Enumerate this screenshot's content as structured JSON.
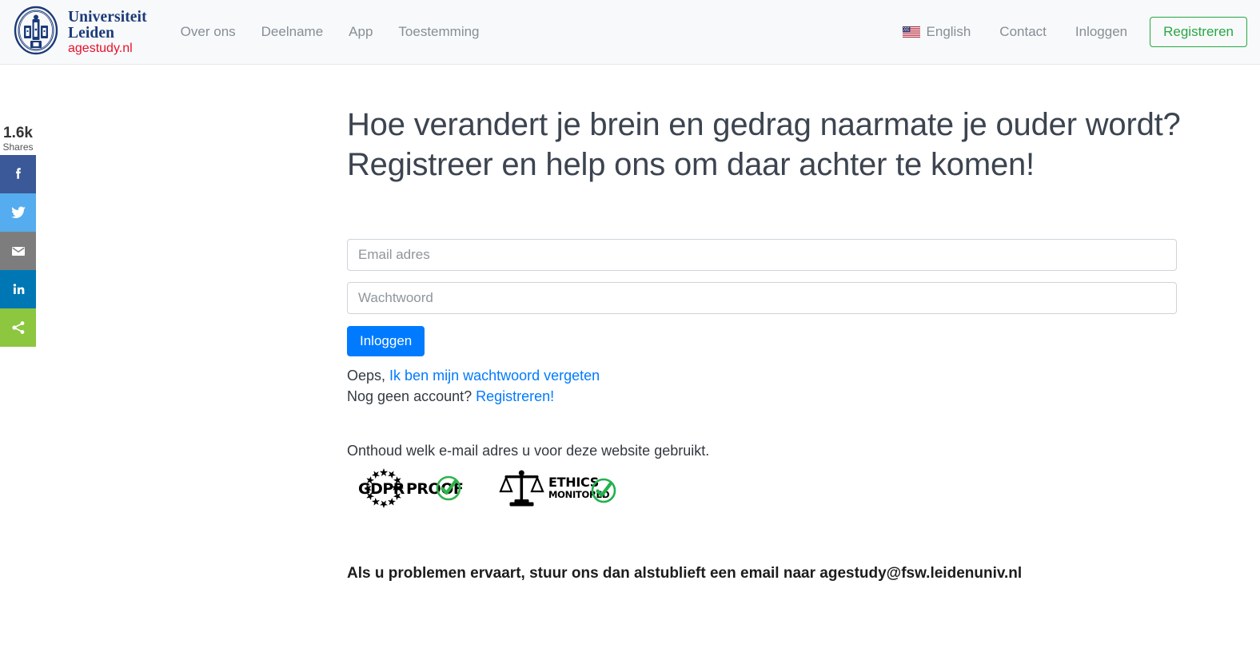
{
  "header": {
    "brand": {
      "university_line1": "Universiteit",
      "university_line2": "Leiden",
      "site": "agestudy.nl",
      "logo_icon": "leiden-university-seal-icon"
    },
    "nav": [
      {
        "label": "Over ons"
      },
      {
        "label": "Deelname"
      },
      {
        "label": "App"
      },
      {
        "label": "Toestemming"
      }
    ],
    "right_nav": [
      {
        "label": "English",
        "icon": "us-flag-icon"
      },
      {
        "label": "Contact"
      },
      {
        "label": "Inloggen"
      }
    ],
    "register_button": "Registreren",
    "accent_green": "#28a745",
    "brand_red": "#e8112d",
    "brand_blue": "#1b3a78"
  },
  "social": {
    "count": "1.6k",
    "count_label": "Shares",
    "buttons": [
      {
        "name": "facebook",
        "icon": "facebook-icon",
        "color": "#3b5998"
      },
      {
        "name": "twitter",
        "icon": "twitter-icon",
        "color": "#55acee"
      },
      {
        "name": "email",
        "icon": "email-icon",
        "color": "#7d7d7d"
      },
      {
        "name": "linkedin",
        "icon": "linkedin-icon",
        "color": "#0077b5"
      },
      {
        "name": "share",
        "icon": "share-icon",
        "color": "#8dc63f"
      }
    ]
  },
  "main": {
    "headline_line1": "Hoe verandert je brein en gedrag naarmate je ouder wordt?",
    "headline_line2": "Registreer en help ons om daar achter te komen!",
    "email_placeholder": "Email adres",
    "email_value": "",
    "password_placeholder": "Wachtwoord",
    "password_value": "",
    "login_button": "Inloggen",
    "login_button_color": "#007bff",
    "forgot_prefix": "Oeps,",
    "forgot_link": "Ik ben mijn wachtwoord vergeten",
    "register_prefix": "Nog geen account?",
    "register_link": "Registreren!",
    "remember_note": "Onthoud welk e-mail adres u voor deze website gebruikt.",
    "badges": [
      {
        "name": "gdpr-proof-badge",
        "text_left": "GDPR",
        "text_right": "PROOF",
        "check_color": "#2fb34a"
      },
      {
        "name": "ethics-monitored-badge",
        "text_top": "ETHICS",
        "text_bottom": "MONITORED",
        "check_color": "#22b14c"
      }
    ],
    "problem_text": "Als u problemen ervaart, stuur ons dan alstublieft een email naar agestudy@fsw.leidenuniv.nl"
  }
}
